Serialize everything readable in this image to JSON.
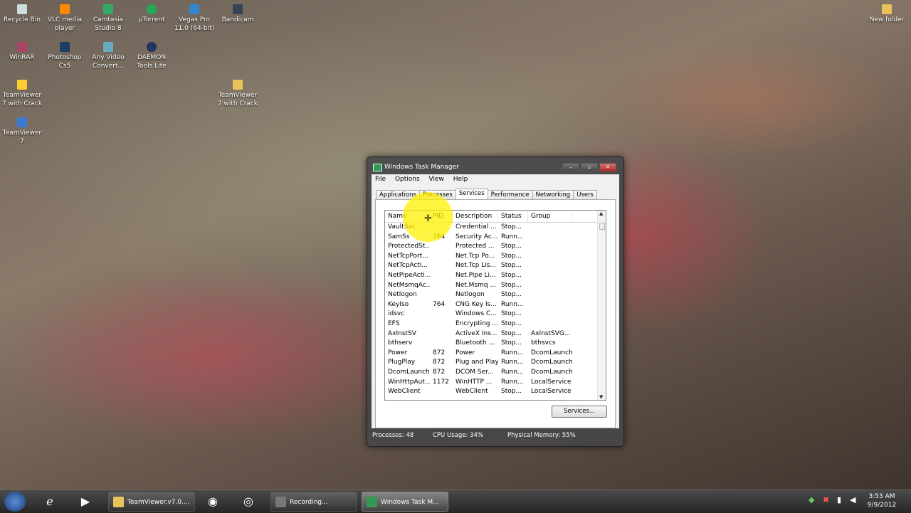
{
  "desktop": {
    "icons": [
      {
        "label": "Recycle Bin",
        "icon": "recycle-bin-icon"
      },
      {
        "label": "VLC media player",
        "icon": "vlc-icon"
      },
      {
        "label": "Camtasia Studio 8",
        "icon": "camtasia-icon"
      },
      {
        "label": "µTorrent",
        "icon": "utorrent-icon"
      },
      {
        "label": "Vegas Pro 11.0 (64-bit)",
        "icon": "vegas-pro-icon"
      },
      {
        "label": "Bandicam",
        "icon": "bandicam-icon"
      },
      {
        "label": "New folder",
        "icon": "folder-icon"
      },
      {
        "label": "WinRAR",
        "icon": "winrar-icon"
      },
      {
        "label": "Photoshop Cs5",
        "icon": "photoshop-icon"
      },
      {
        "label": "Any Video Convert...",
        "icon": "video-converter-icon"
      },
      {
        "label": "DAEMON Tools Lite",
        "icon": "daemon-tools-icon"
      },
      {
        "label": "TeamViewer 7 with Crack",
        "icon": "teamviewer-icon"
      },
      {
        "label": "TeamViewer 7 with Crack",
        "icon": "folder-icon"
      },
      {
        "label": "TeamViewer 7",
        "icon": "teamviewer-icon"
      }
    ]
  },
  "window": {
    "title": "Windows Task Manager",
    "controls": {
      "minimize": "–",
      "maximize": "▫",
      "close": "✕"
    },
    "menu": [
      "File",
      "Options",
      "View",
      "Help"
    ],
    "tabs": [
      "Applications",
      "Processes",
      "Services",
      "Performance",
      "Networking",
      "Users"
    ],
    "active_tab": "Services",
    "columns": [
      "Name",
      "PID",
      "Description",
      "Status",
      "Group"
    ],
    "sort_indicator": "˄",
    "rows": [
      [
        "VaultSvc",
        "",
        "Credential ...",
        "Stop...",
        ""
      ],
      [
        "SamSs",
        "764",
        "Security Ac...",
        "Runn...",
        ""
      ],
      [
        "ProtectedSt...",
        "",
        "Protected ...",
        "Stop...",
        ""
      ],
      [
        "NetTcpPort...",
        "",
        "Net.Tcp Po...",
        "Stop...",
        ""
      ],
      [
        "NetTcpActi...",
        "",
        "Net.Tcp Lis...",
        "Stop...",
        ""
      ],
      [
        "NetPipeActi...",
        "",
        "Net.Pipe Li...",
        "Stop...",
        ""
      ],
      [
        "NetMsmqAc...",
        "",
        "Net.Msmq ...",
        "Stop...",
        ""
      ],
      [
        "Netlogon",
        "",
        "Netlogon",
        "Stop...",
        ""
      ],
      [
        "KeyIso",
        "764",
        "CNG Key Is...",
        "Runn...",
        ""
      ],
      [
        "idsvc",
        "",
        "Windows C...",
        "Stop...",
        ""
      ],
      [
        "EFS",
        "",
        "Encrypting ...",
        "Stop...",
        ""
      ],
      [
        "AxInstSV",
        "",
        "ActiveX Ins...",
        "Stop...",
        "AxInstSVG..."
      ],
      [
        "bthserv",
        "",
        "Bluetooth ...",
        "Stop...",
        "bthsvcs"
      ],
      [
        "Power",
        "872",
        "Power",
        "Runn...",
        "DcomLaunch"
      ],
      [
        "PlugPlay",
        "872",
        "Plug and Play",
        "Runn...",
        "DcomLaunch"
      ],
      [
        "DcomLaunch",
        "872",
        "DCOM Ser...",
        "Runn...",
        "DcomLaunch"
      ],
      [
        "WinHttpAut...",
        "1172",
        "WinHTTP ...",
        "Runn...",
        "LocalService"
      ],
      [
        "WebClient",
        "",
        "WebClient",
        "Stop...",
        "LocalService"
      ]
    ],
    "services_button": "Services...",
    "status": {
      "processes": "Processes: 48",
      "cpu": "CPU Usage: 34%",
      "memory": "Physical Memory: 55%"
    }
  },
  "taskbar": {
    "buttons": [
      {
        "label": "TeamViewer.v7.0....",
        "icon": "folder-icon"
      },
      {
        "label": "Recording...",
        "icon": "bandicam-icon"
      },
      {
        "label": "Windows Task M...",
        "icon": "task-manager-icon"
      }
    ],
    "pinned": [
      "internet-explorer-icon",
      "media-player-icon",
      "firefox-icon",
      "chrome-icon"
    ],
    "clock": {
      "time": "3:53 AM",
      "date": "9/9/2012"
    }
  }
}
